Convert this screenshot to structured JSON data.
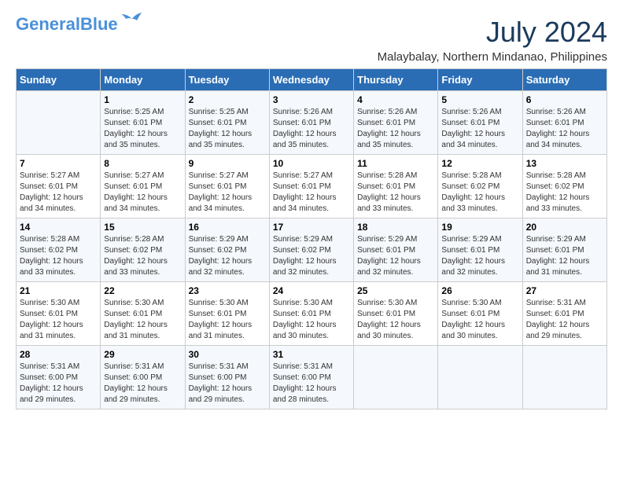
{
  "header": {
    "logo_line1": "General",
    "logo_line2": "Blue",
    "month_year": "July 2024",
    "location": "Malaybalay, Northern Mindanao, Philippines"
  },
  "weekdays": [
    "Sunday",
    "Monday",
    "Tuesday",
    "Wednesday",
    "Thursday",
    "Friday",
    "Saturday"
  ],
  "weeks": [
    [
      {
        "day": "",
        "sunrise": "",
        "sunset": "",
        "daylight": ""
      },
      {
        "day": "1",
        "sunrise": "Sunrise: 5:25 AM",
        "sunset": "Sunset: 6:01 PM",
        "daylight": "Daylight: 12 hours and 35 minutes."
      },
      {
        "day": "2",
        "sunrise": "Sunrise: 5:25 AM",
        "sunset": "Sunset: 6:01 PM",
        "daylight": "Daylight: 12 hours and 35 minutes."
      },
      {
        "day": "3",
        "sunrise": "Sunrise: 5:26 AM",
        "sunset": "Sunset: 6:01 PM",
        "daylight": "Daylight: 12 hours and 35 minutes."
      },
      {
        "day": "4",
        "sunrise": "Sunrise: 5:26 AM",
        "sunset": "Sunset: 6:01 PM",
        "daylight": "Daylight: 12 hours and 35 minutes."
      },
      {
        "day": "5",
        "sunrise": "Sunrise: 5:26 AM",
        "sunset": "Sunset: 6:01 PM",
        "daylight": "Daylight: 12 hours and 34 minutes."
      },
      {
        "day": "6",
        "sunrise": "Sunrise: 5:26 AM",
        "sunset": "Sunset: 6:01 PM",
        "daylight": "Daylight: 12 hours and 34 minutes."
      }
    ],
    [
      {
        "day": "7",
        "sunrise": "Sunrise: 5:27 AM",
        "sunset": "Sunset: 6:01 PM",
        "daylight": "Daylight: 12 hours and 34 minutes."
      },
      {
        "day": "8",
        "sunrise": "Sunrise: 5:27 AM",
        "sunset": "Sunset: 6:01 PM",
        "daylight": "Daylight: 12 hours and 34 minutes."
      },
      {
        "day": "9",
        "sunrise": "Sunrise: 5:27 AM",
        "sunset": "Sunset: 6:01 PM",
        "daylight": "Daylight: 12 hours and 34 minutes."
      },
      {
        "day": "10",
        "sunrise": "Sunrise: 5:27 AM",
        "sunset": "Sunset: 6:01 PM",
        "daylight": "Daylight: 12 hours and 34 minutes."
      },
      {
        "day": "11",
        "sunrise": "Sunrise: 5:28 AM",
        "sunset": "Sunset: 6:01 PM",
        "daylight": "Daylight: 12 hours and 33 minutes."
      },
      {
        "day": "12",
        "sunrise": "Sunrise: 5:28 AM",
        "sunset": "Sunset: 6:02 PM",
        "daylight": "Daylight: 12 hours and 33 minutes."
      },
      {
        "day": "13",
        "sunrise": "Sunrise: 5:28 AM",
        "sunset": "Sunset: 6:02 PM",
        "daylight": "Daylight: 12 hours and 33 minutes."
      }
    ],
    [
      {
        "day": "14",
        "sunrise": "Sunrise: 5:28 AM",
        "sunset": "Sunset: 6:02 PM",
        "daylight": "Daylight: 12 hours and 33 minutes."
      },
      {
        "day": "15",
        "sunrise": "Sunrise: 5:28 AM",
        "sunset": "Sunset: 6:02 PM",
        "daylight": "Daylight: 12 hours and 33 minutes."
      },
      {
        "day": "16",
        "sunrise": "Sunrise: 5:29 AM",
        "sunset": "Sunset: 6:02 PM",
        "daylight": "Daylight: 12 hours and 32 minutes."
      },
      {
        "day": "17",
        "sunrise": "Sunrise: 5:29 AM",
        "sunset": "Sunset: 6:02 PM",
        "daylight": "Daylight: 12 hours and 32 minutes."
      },
      {
        "day": "18",
        "sunrise": "Sunrise: 5:29 AM",
        "sunset": "Sunset: 6:01 PM",
        "daylight": "Daylight: 12 hours and 32 minutes."
      },
      {
        "day": "19",
        "sunrise": "Sunrise: 5:29 AM",
        "sunset": "Sunset: 6:01 PM",
        "daylight": "Daylight: 12 hours and 32 minutes."
      },
      {
        "day": "20",
        "sunrise": "Sunrise: 5:29 AM",
        "sunset": "Sunset: 6:01 PM",
        "daylight": "Daylight: 12 hours and 31 minutes."
      }
    ],
    [
      {
        "day": "21",
        "sunrise": "Sunrise: 5:30 AM",
        "sunset": "Sunset: 6:01 PM",
        "daylight": "Daylight: 12 hours and 31 minutes."
      },
      {
        "day": "22",
        "sunrise": "Sunrise: 5:30 AM",
        "sunset": "Sunset: 6:01 PM",
        "daylight": "Daylight: 12 hours and 31 minutes."
      },
      {
        "day": "23",
        "sunrise": "Sunrise: 5:30 AM",
        "sunset": "Sunset: 6:01 PM",
        "daylight": "Daylight: 12 hours and 31 minutes."
      },
      {
        "day": "24",
        "sunrise": "Sunrise: 5:30 AM",
        "sunset": "Sunset: 6:01 PM",
        "daylight": "Daylight: 12 hours and 30 minutes."
      },
      {
        "day": "25",
        "sunrise": "Sunrise: 5:30 AM",
        "sunset": "Sunset: 6:01 PM",
        "daylight": "Daylight: 12 hours and 30 minutes."
      },
      {
        "day": "26",
        "sunrise": "Sunrise: 5:30 AM",
        "sunset": "Sunset: 6:01 PM",
        "daylight": "Daylight: 12 hours and 30 minutes."
      },
      {
        "day": "27",
        "sunrise": "Sunrise: 5:31 AM",
        "sunset": "Sunset: 6:01 PM",
        "daylight": "Daylight: 12 hours and 29 minutes."
      }
    ],
    [
      {
        "day": "28",
        "sunrise": "Sunrise: 5:31 AM",
        "sunset": "Sunset: 6:00 PM",
        "daylight": "Daylight: 12 hours and 29 minutes."
      },
      {
        "day": "29",
        "sunrise": "Sunrise: 5:31 AM",
        "sunset": "Sunset: 6:00 PM",
        "daylight": "Daylight: 12 hours and 29 minutes."
      },
      {
        "day": "30",
        "sunrise": "Sunrise: 5:31 AM",
        "sunset": "Sunset: 6:00 PM",
        "daylight": "Daylight: 12 hours and 29 minutes."
      },
      {
        "day": "31",
        "sunrise": "Sunrise: 5:31 AM",
        "sunset": "Sunset: 6:00 PM",
        "daylight": "Daylight: 12 hours and 28 minutes."
      },
      {
        "day": "",
        "sunrise": "",
        "sunset": "",
        "daylight": ""
      },
      {
        "day": "",
        "sunrise": "",
        "sunset": "",
        "daylight": ""
      },
      {
        "day": "",
        "sunrise": "",
        "sunset": "",
        "daylight": ""
      }
    ]
  ]
}
